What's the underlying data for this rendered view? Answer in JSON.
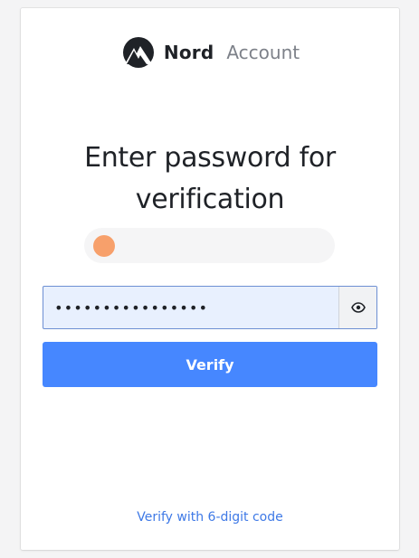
{
  "brand": {
    "name": "Nord",
    "product": "Account",
    "logo_icon": "nord-mountain-logo"
  },
  "heading": "Enter password for verification",
  "account_chip": {
    "avatar_color": "#f7a06b",
    "email": ""
  },
  "password_field": {
    "value": "••••••••••••••••",
    "reveal_icon": "eye-icon"
  },
  "verify_button": {
    "label": "Verify",
    "color": "#4687ff"
  },
  "alt_link": {
    "label": "Verify with 6-digit code"
  }
}
